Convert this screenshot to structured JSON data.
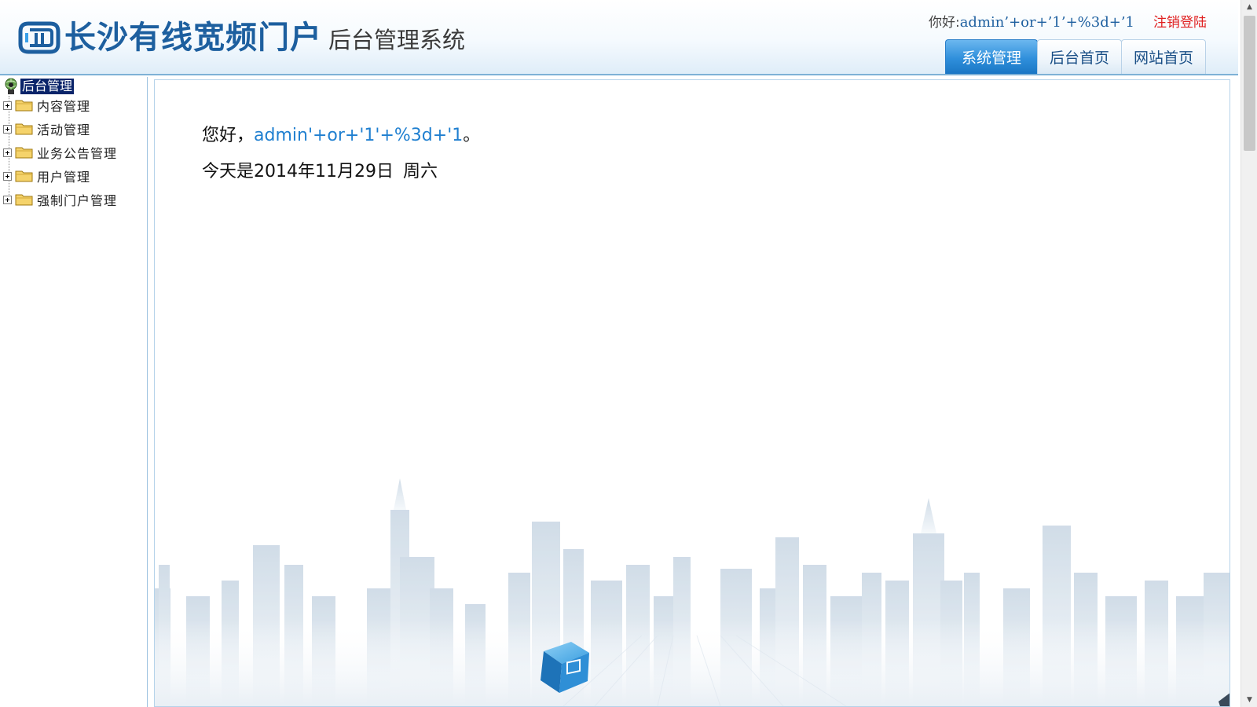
{
  "header": {
    "title": "长沙有线宽频门户",
    "subtitle": "后台管理系统",
    "greeting_label": "你好:",
    "username": "admin’+or+’1’+%3d+’1",
    "logout_label": "注销登陆",
    "tabs": [
      {
        "label": "系统管理",
        "active": true
      },
      {
        "label": "后台首页",
        "active": false
      },
      {
        "label": "网站首页",
        "active": false
      }
    ]
  },
  "sidebar": {
    "root_label": "后台管理",
    "items": [
      {
        "label": "内容管理"
      },
      {
        "label": "活动管理"
      },
      {
        "label": "业务公告管理"
      },
      {
        "label": "用户管理"
      },
      {
        "label": "强制门户管理"
      }
    ]
  },
  "main": {
    "greeting_prefix": "您好，",
    "username": "admin'+or+'1'+%3d+'1",
    "greeting_suffix": "。",
    "date_text": "今天是2014年11月29日",
    "weekday": "周六"
  },
  "colors": {
    "brand": "#1d5f9f",
    "accent": "#2f8fdb",
    "logout": "#e02020",
    "username_main": "#1f7fd0",
    "tree_selected_bg": "#0a246a"
  },
  "icons": {
    "logo": "logo-mark-icon",
    "tree_root": "globe-user-icon",
    "tree_expand": "plus-box-icon",
    "tree_folder": "folder-icon",
    "city": "city-skyline-illustration"
  }
}
